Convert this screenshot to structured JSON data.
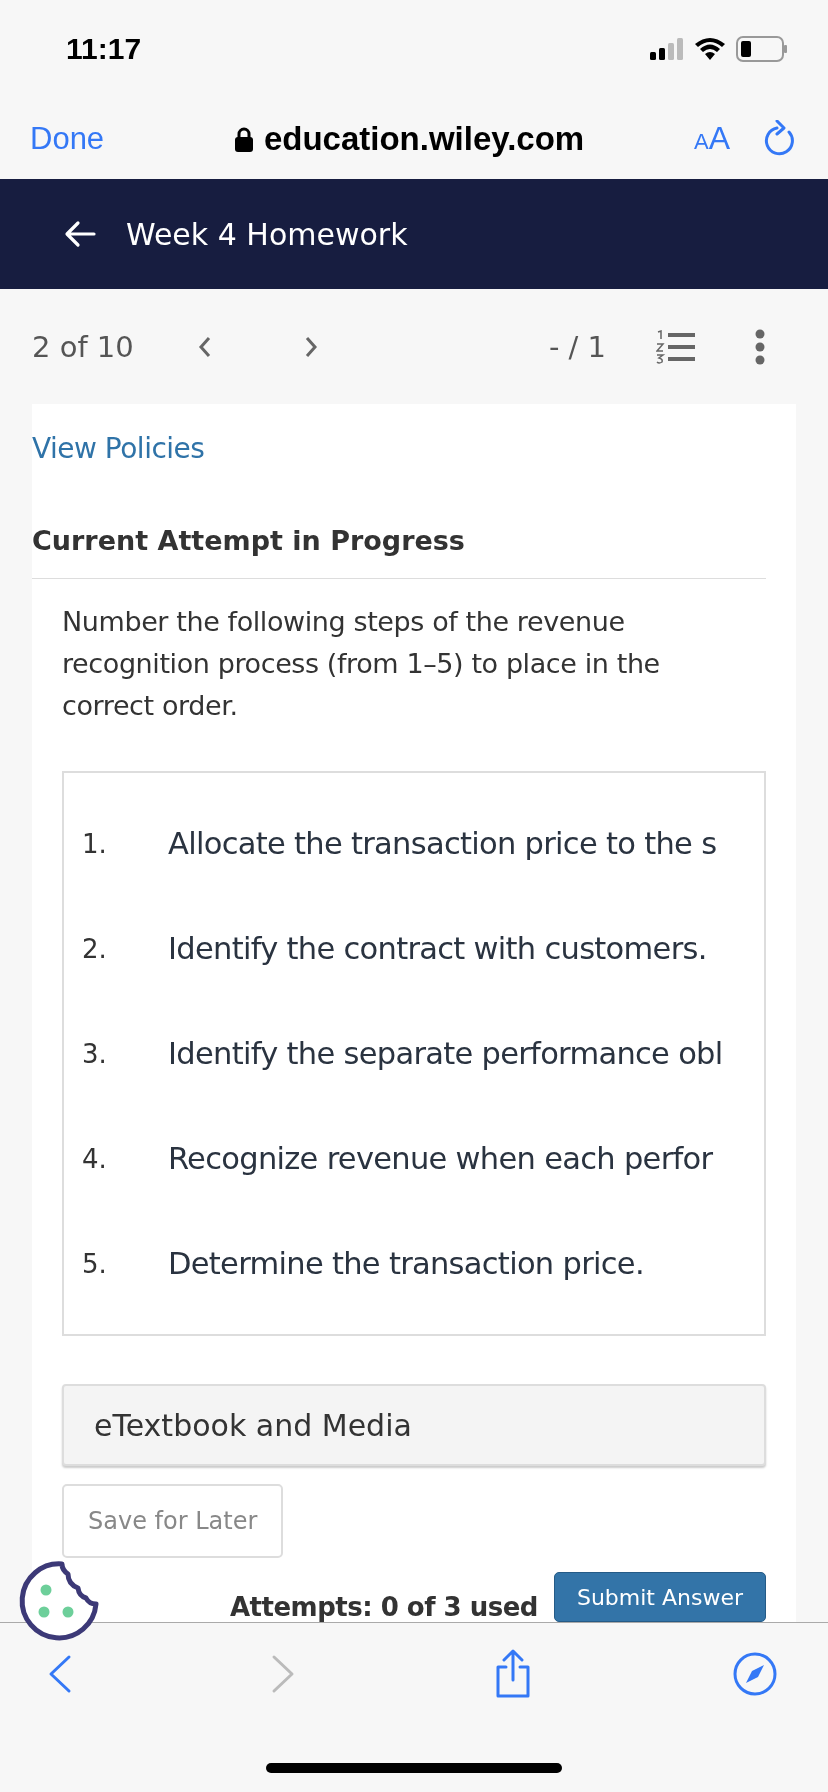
{
  "status_bar": {
    "time": "11:17"
  },
  "browser": {
    "done": "Done",
    "url": "education.wiley.com",
    "text_size": "AA"
  },
  "header": {
    "title": "Week 4 Homework"
  },
  "toolbar": {
    "position": "2 of 10",
    "score": "- / 1"
  },
  "card": {
    "link": "View Policies",
    "heading": "Current Attempt in Progress",
    "question": "Number the following steps of the revenue recognition process (from 1–5) to place in the correct order.",
    "steps": [
      {
        "number": "1.",
        "text": "Allocate the transaction price to the s"
      },
      {
        "number": "2.",
        "text": "Identify the contract with customers."
      },
      {
        "number": "3.",
        "text": "Identify the separate performance obl"
      },
      {
        "number": "4.",
        "text": "Recognize revenue when each perfor"
      },
      {
        "number": "5.",
        "text": "Determine the transaction price."
      }
    ],
    "resources": "eTextbook and Media",
    "save": "Save for Later",
    "attempts": "Attempts: 0 of 3 used",
    "submit": "Submit Answer"
  },
  "bottom_nav": [
    {
      "kind": "back",
      "disabled": false
    },
    {
      "kind": "forward",
      "disabled": true
    },
    {
      "kind": "share",
      "disabled": false
    },
    {
      "kind": "compass",
      "disabled": false
    }
  ]
}
